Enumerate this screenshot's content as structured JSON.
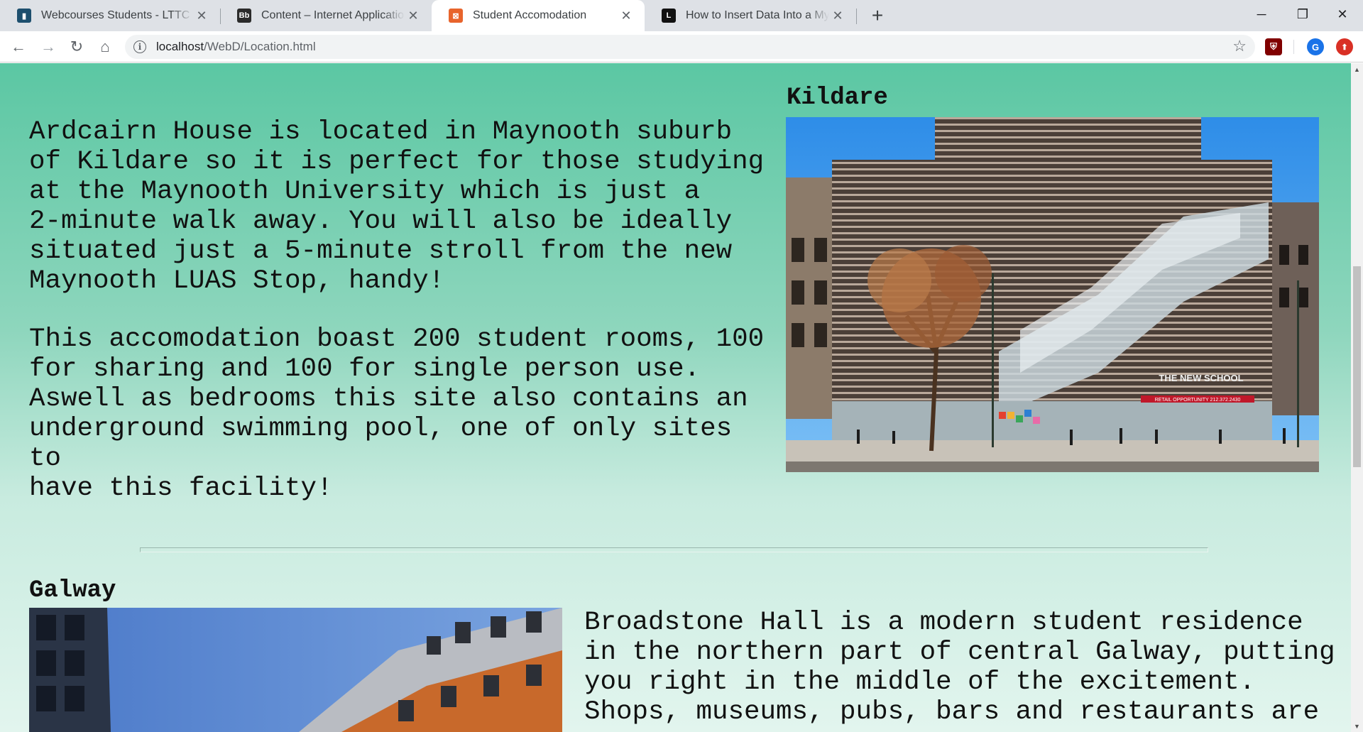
{
  "browser": {
    "tabs": [
      {
        "title": "Webcourses Students - LTTC",
        "favicon_color": "#1d4f6e"
      },
      {
        "title": "Content – Internet Application and",
        "favicon_color": "#2b2b2b",
        "favicon_text": "Bb"
      },
      {
        "title": "Student Accomodation",
        "favicon_color": "#e8642c",
        "active": true
      },
      {
        "title": "How to Insert Data Into a MySQL",
        "favicon_color": "#111111",
        "favicon_text": "L"
      }
    ],
    "url_host": "localhost",
    "url_path": "/WebD/Location.html",
    "ext_profile_letter": "G"
  },
  "page": {
    "kildare": {
      "heading": "Kildare",
      "paragraph1": "Ardcairn House is located in Maynooth suburb\nof Kildare so it is perfect for those studying\nat the Maynooth University which is just a\n2-minute walk away. You will also be ideally\nsituated just a 5-minute stroll from the new\nMaynooth LUAS Stop, handy!",
      "paragraph2": "This accomodation boast 200 student rooms, 100\nfor sharing and 100 for single person use.\nAswell as bedrooms this site also contains an\nunderground swimming pool, one of only sites\nto\nhave this facility!",
      "image_sign_text": "THE NEW SCHOOL",
      "image_banner_text": "RETAIL OPPORTUNITY 212.372.2430"
    },
    "galway": {
      "heading": "Galway",
      "paragraph": "Broadstone Hall is a modern student residence\nin the northern part of central Galway, putting\nyou right in the middle of the excitement.\nShops, museums, pubs, bars and restaurants are"
    }
  },
  "colors": {
    "page_gradient_top": "#5bc7a3",
    "page_gradient_bottom": "#e2f5ee"
  }
}
